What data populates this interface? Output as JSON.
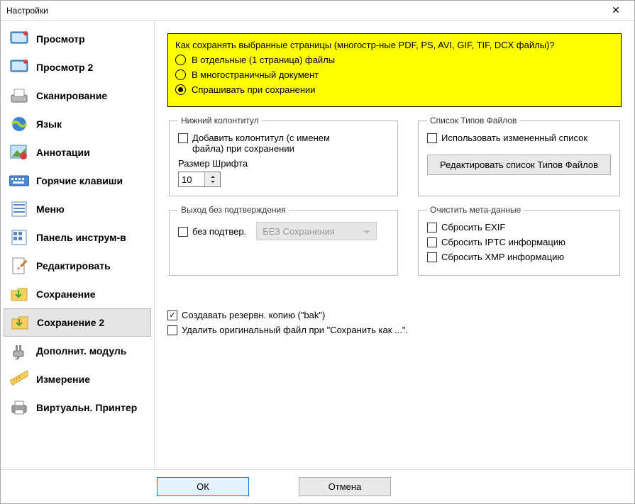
{
  "window": {
    "title": "Настройки",
    "close": "✕"
  },
  "sidebar": {
    "items": [
      {
        "label": "Просмотр",
        "icon": "display-icon"
      },
      {
        "label": "Просмотр 2",
        "icon": "display-icon"
      },
      {
        "label": "Сканирование",
        "icon": "scanner-icon"
      },
      {
        "label": "Язык",
        "icon": "globe-icon"
      },
      {
        "label": "Аннотации",
        "icon": "image-edit-icon"
      },
      {
        "label": "Горячие клавиши",
        "icon": "keyboard-icon"
      },
      {
        "label": "Меню",
        "icon": "menu-icon"
      },
      {
        "label": "Панель инструм-в",
        "icon": "grid-icon"
      },
      {
        "label": "Редактировать",
        "icon": "edit-icon"
      },
      {
        "label": "Сохранение",
        "icon": "save-folder-icon"
      },
      {
        "label": "Сохранение 2",
        "icon": "save-folder-icon"
      },
      {
        "label": "Дополнит. модуль",
        "icon": "plugin-icon"
      },
      {
        "label": "Измерение",
        "icon": "ruler-icon"
      },
      {
        "label": "Виртуальн. Принтер",
        "icon": "printer-icon"
      }
    ],
    "selected_index": 10
  },
  "highlighted": {
    "question": "Как сохранять выбранные страницы (многостр-ные PDF, PS, AVI, GIF, TIF, DCX файлы)?",
    "opt1": "В отдельные (1 страница) файлы",
    "opt2": "В многостраничный документ",
    "opt3": "Спрашивать при сохранении",
    "selected": 2
  },
  "footer_box": {
    "legend": "Нижний колонтитул",
    "add_footer_label": "Добавить колонтитул (с именем файла) при сохранении",
    "add_footer_checked": false,
    "font_size_label": "Размер Шрифта",
    "font_size_value": "10"
  },
  "file_types": {
    "legend": "Список Типов Файлов",
    "use_custom_label": "Использовать измененный список",
    "use_custom_checked": false,
    "edit_button": "Редактировать список Типов Файлов"
  },
  "exit": {
    "legend": "Выход без подтверждения",
    "without_confirm_label": "без подтвер.",
    "without_confirm_checked": false,
    "dropdown_label": "БЕЗ Сохранения"
  },
  "meta": {
    "legend": "Очистить мета-данные",
    "reset_exif": "Сбросить EXIF",
    "reset_iptc": "Сбросить IPTC информацию",
    "reset_xmp": "Сбросить XMP информацию"
  },
  "bottom_checks": {
    "backup_label": "Создавать резервн. копию (\"bak\")",
    "backup_checked": true,
    "delete_label": "Удалить оригинальный файл при \"Сохранить как ...\"."
  },
  "buttons": {
    "ok": "ОК",
    "cancel": "Отмена"
  }
}
